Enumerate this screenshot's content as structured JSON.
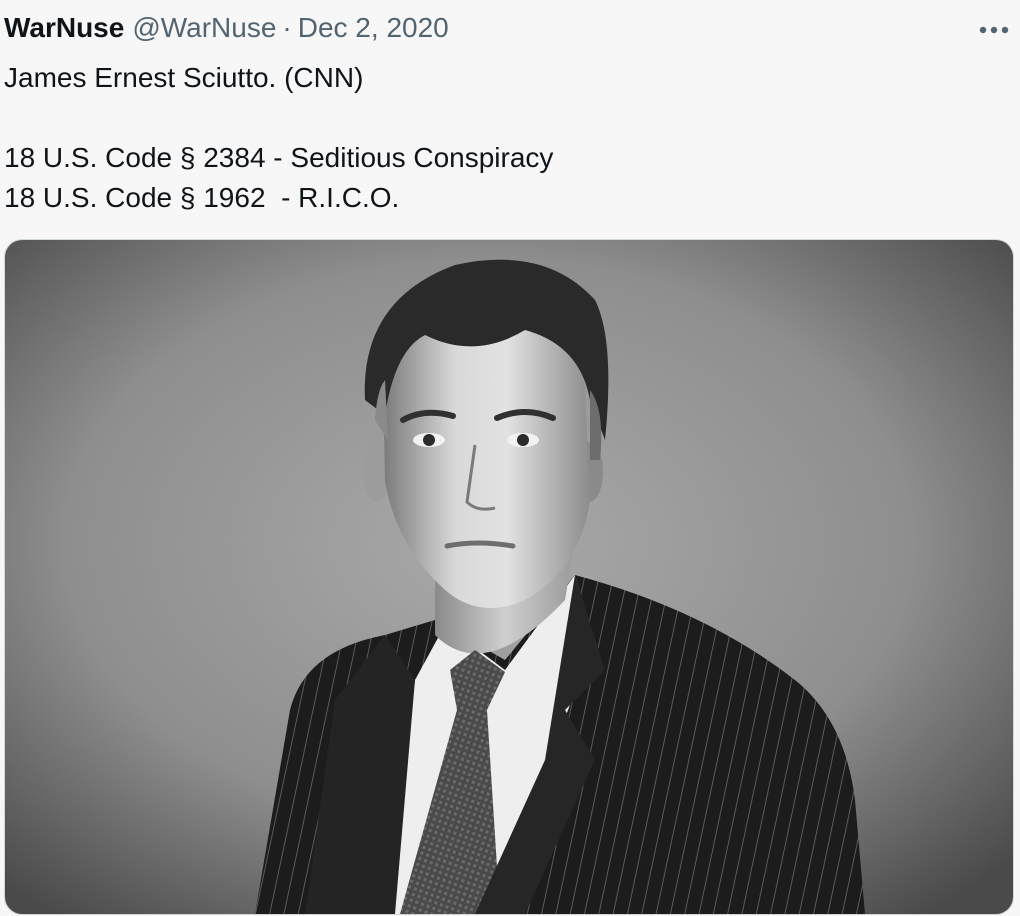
{
  "tweet": {
    "display_name": "WarNuse",
    "handle": "@WarNuse",
    "separator": "·",
    "date": "Dec 2, 2020",
    "text_lines": [
      "James Ernest Sciutto. (CNN)",
      "",
      "18 U.S. Code § 2384 - Seditious Conspiracy",
      "18 U.S. Code § 1962  - R.I.C.O."
    ]
  },
  "media": {
    "kind": "black-and-white portrait photo",
    "icon": "photo"
  },
  "icons": {
    "more": "more-horizontal-icon"
  },
  "colors": {
    "text_primary": "#0f1419",
    "text_secondary": "#536471",
    "background": "#f7f7f7",
    "media_border": "#cfd9de"
  }
}
